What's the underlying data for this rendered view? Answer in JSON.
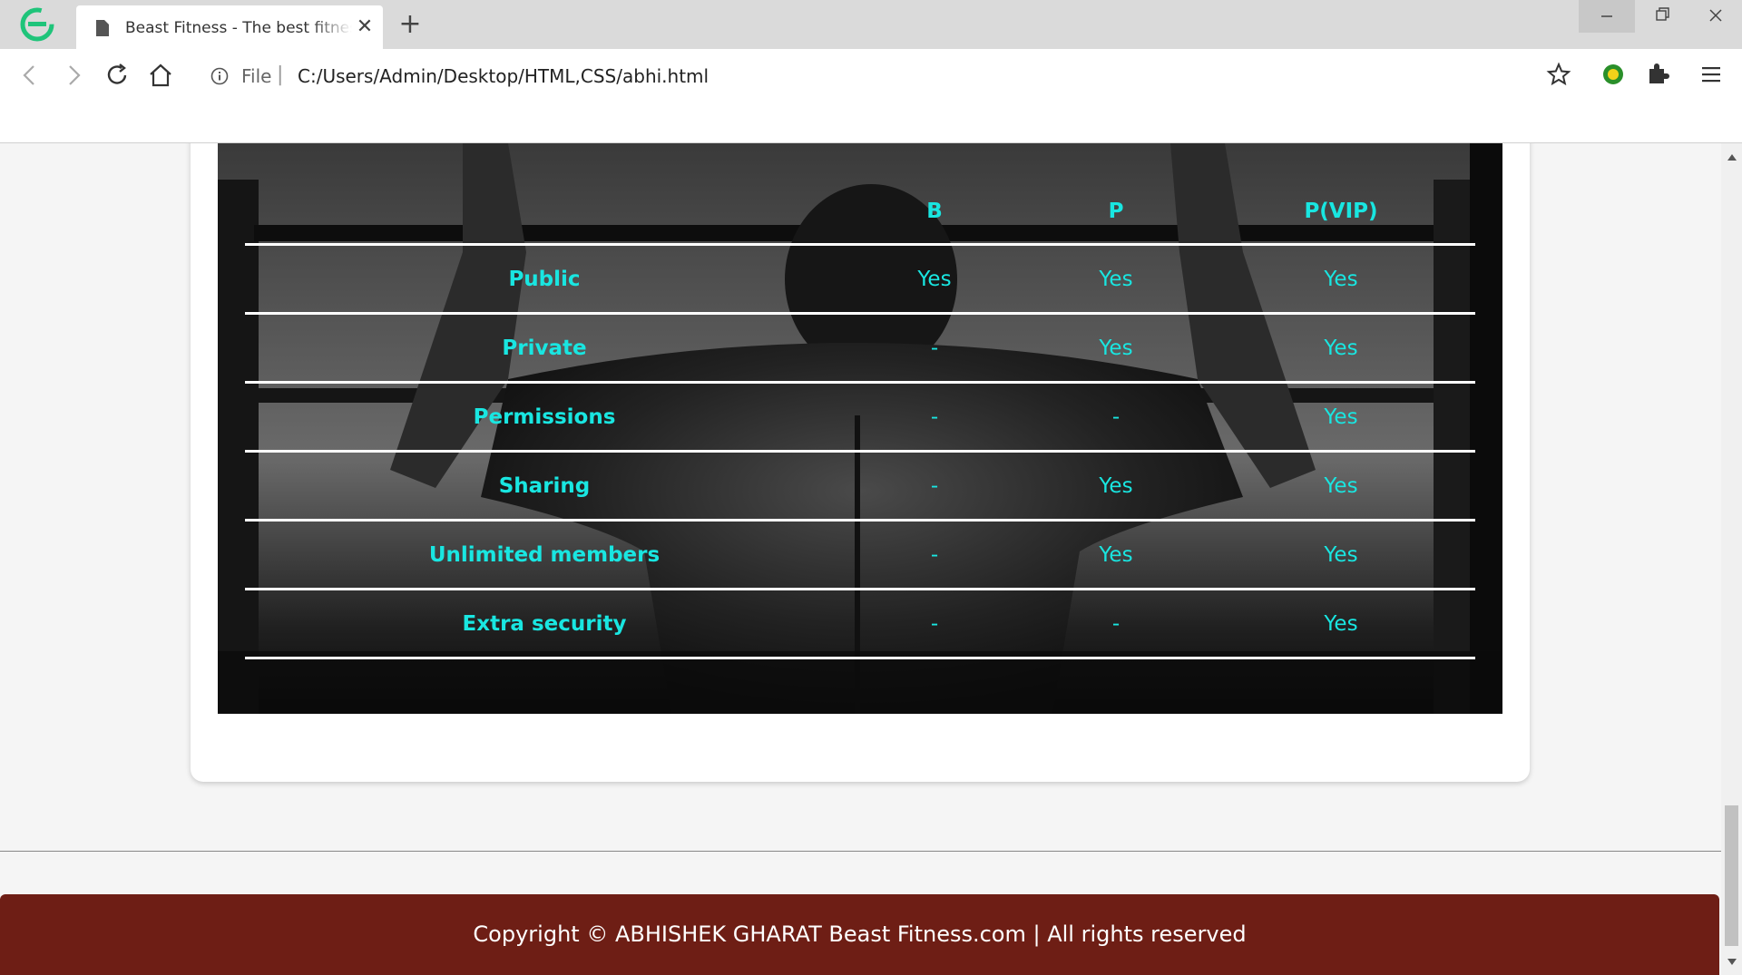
{
  "browser": {
    "tab_title": "Beast Fitness - The best fitness",
    "url_scheme": "File",
    "url": "C:/Users/Admin/Desktop/HTML,CSS/abhi.html",
    "new_tab_symbol": "+",
    "close_symbol": "✕",
    "scheme_separator": "|"
  },
  "plans": {
    "headers": [
      "",
      "B",
      "P",
      "P(VIP)"
    ],
    "rows": [
      {
        "feature": "Public",
        "b": "Yes",
        "p": "Yes",
        "vip": "Yes"
      },
      {
        "feature": "Private",
        "b": "-",
        "p": "Yes",
        "vip": "Yes"
      },
      {
        "feature": "Permissions",
        "b": "-",
        "p": "-",
        "vip": "Yes"
      },
      {
        "feature": "Sharing",
        "b": "-",
        "p": "Yes",
        "vip": "Yes"
      },
      {
        "feature": "Unlimited members",
        "b": "-",
        "p": "Yes",
        "vip": "Yes"
      },
      {
        "feature": "Extra security",
        "b": "-",
        "p": "-",
        "vip": "Yes"
      }
    ]
  },
  "footer": {
    "text": "Copyright © ABHISHEK GHARAT Beast Fitness.com | All rights reserved"
  },
  "colors": {
    "table_text": "#19e6e1",
    "footer_bg": "#6e1e15",
    "browser_logo": "#1fc47a"
  }
}
